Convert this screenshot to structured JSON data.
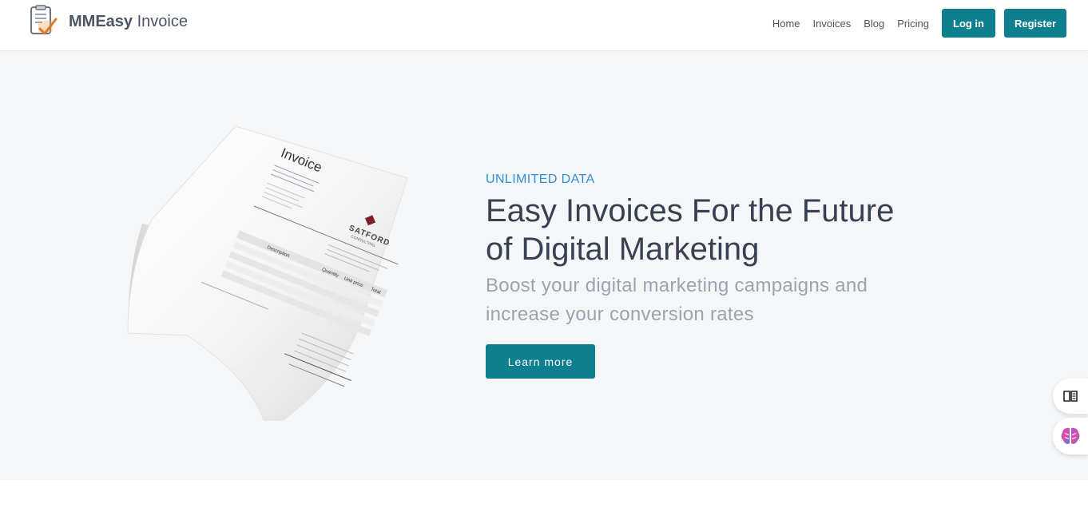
{
  "header": {
    "brand_bold": "MMEasy",
    "brand_light": "Invoice",
    "nav": [
      {
        "label": "Home"
      },
      {
        "label": "Invoices"
      },
      {
        "label": "Blog"
      },
      {
        "label": "Pricing"
      }
    ],
    "login_label": "Log in",
    "register_label": "Register"
  },
  "hero": {
    "eyebrow": "UNLIMITED DATA",
    "headline_light": "Easy Invoices For the ",
    "headline_strong_1": "Future",
    "headline_strong_2": "of Digital Marketing",
    "subline": "Boost your digital marketing campaigns and increase your conversion rates",
    "cta_label": "Learn more",
    "image": {
      "title": "Invoice",
      "brand": "SATFORD",
      "brand_sub": "CONSULTING",
      "col_description": "Description",
      "col_quantity": "Quantity",
      "col_unit_price": "Unit price",
      "col_total": "Total"
    }
  },
  "colors": {
    "accent": "#0e7f8f",
    "eyebrow": "#2f8fd8",
    "hero_bg": "#f5f6f8"
  },
  "icons": [
    "invoice-logo-icon",
    "book-icon",
    "brain-icon"
  ]
}
